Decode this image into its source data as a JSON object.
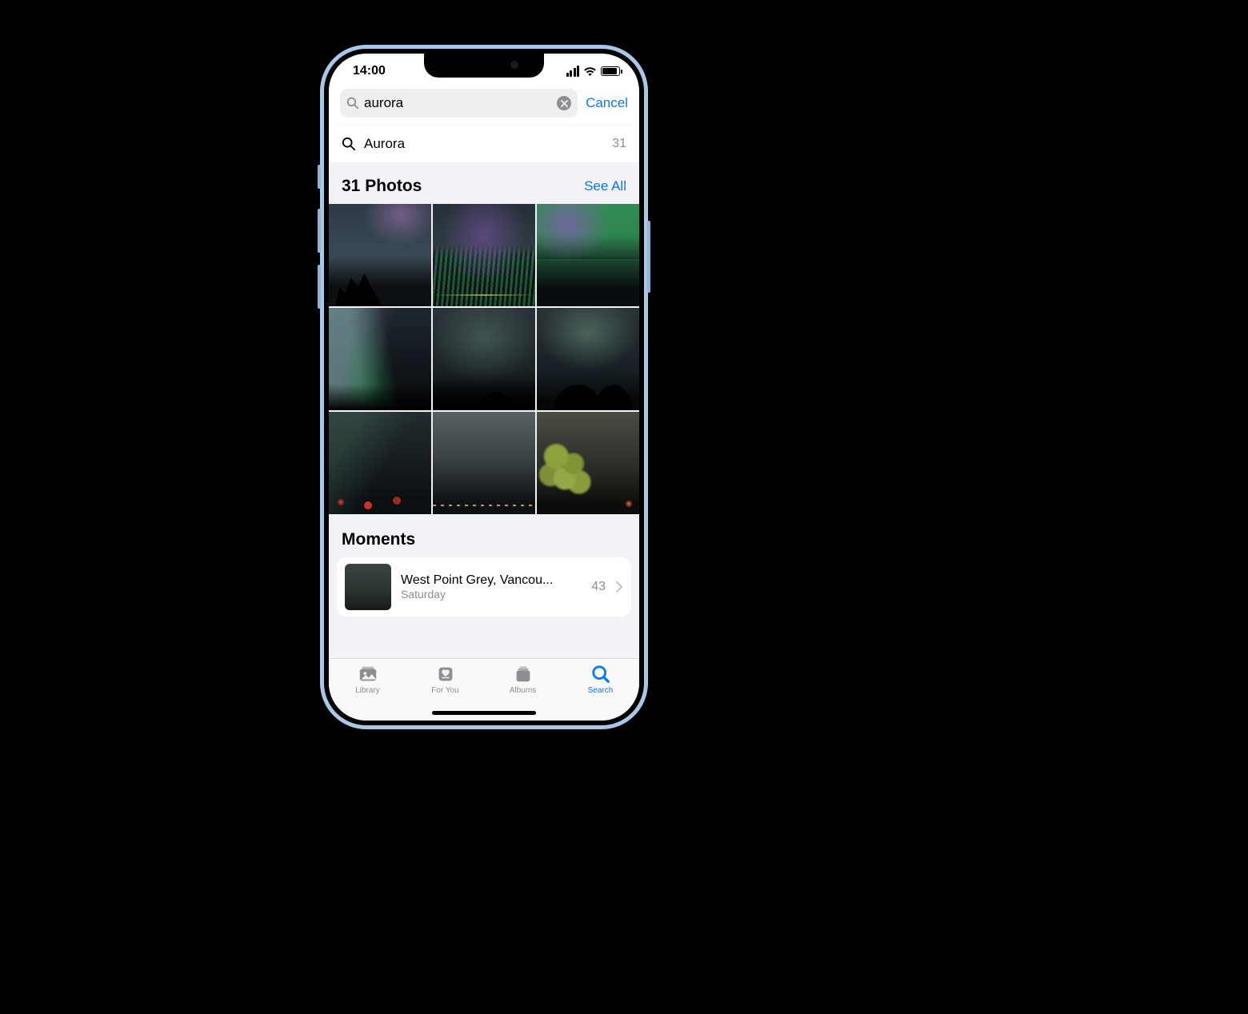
{
  "status": {
    "time": "14:00"
  },
  "search": {
    "query": "aurora",
    "cancel": "Cancel",
    "suggestion_label": "Aurora",
    "suggestion_count": "31"
  },
  "results": {
    "header": "31 Photos",
    "see_all": "See All"
  },
  "moments": {
    "header": "Moments",
    "items": [
      {
        "title": "West Point Grey, Vancou...",
        "subtitle": "Saturday",
        "count": "43"
      }
    ]
  },
  "tabs": {
    "library": "Library",
    "for_you": "For You",
    "albums": "Albums",
    "search": "Search"
  }
}
